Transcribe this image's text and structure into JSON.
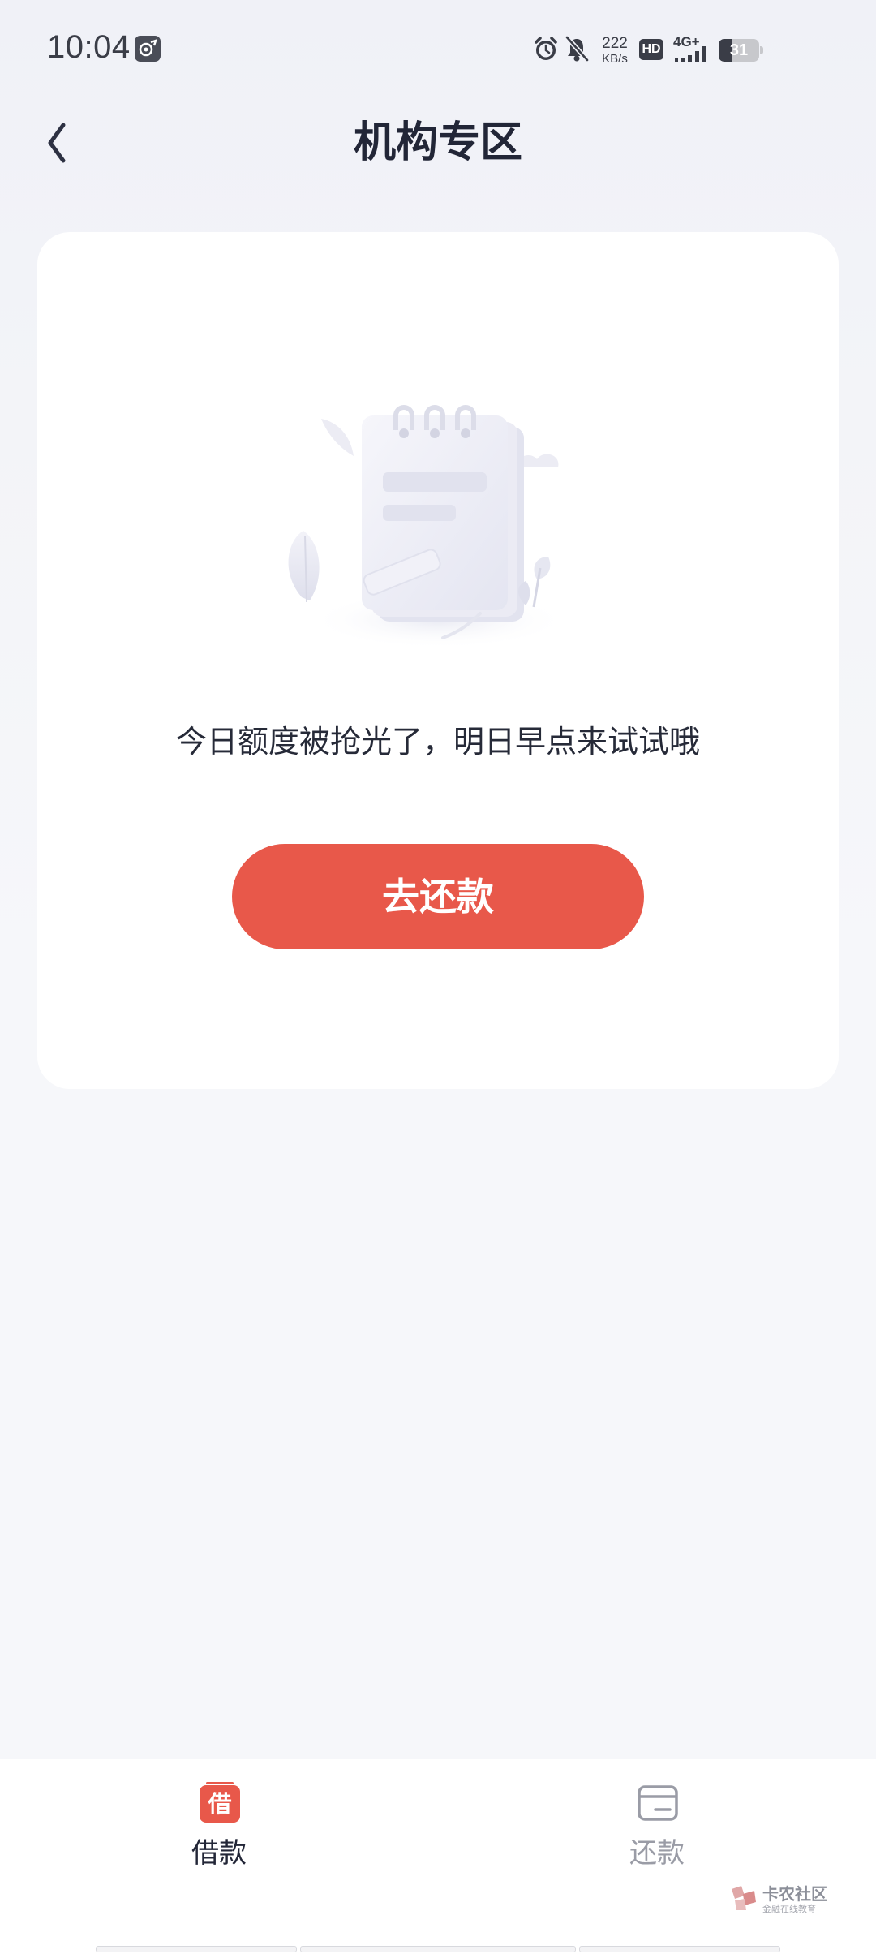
{
  "status_bar": {
    "time": "10:04",
    "network_speed_value": "222",
    "network_speed_unit": "KB/s",
    "hd_label": "HD",
    "signal_label": "4G+",
    "battery_level": "31"
  },
  "header": {
    "title": "机构专区"
  },
  "card": {
    "empty_message": "今日额度被抢光了，明日早点来试试哦",
    "repay_button_label": "去还款"
  },
  "tab_bar": {
    "tabs": [
      {
        "label": "借款",
        "icon_char": "借",
        "active": true
      },
      {
        "label": "还款",
        "active": false
      }
    ]
  },
  "watermark": {
    "name": "卡农社区",
    "subtitle": "金融在线教育"
  },
  "colors": {
    "accent": "#e8584a",
    "text_primary": "#222637",
    "text_inactive": "#9a9ca6",
    "background": "#f6f7fa"
  }
}
